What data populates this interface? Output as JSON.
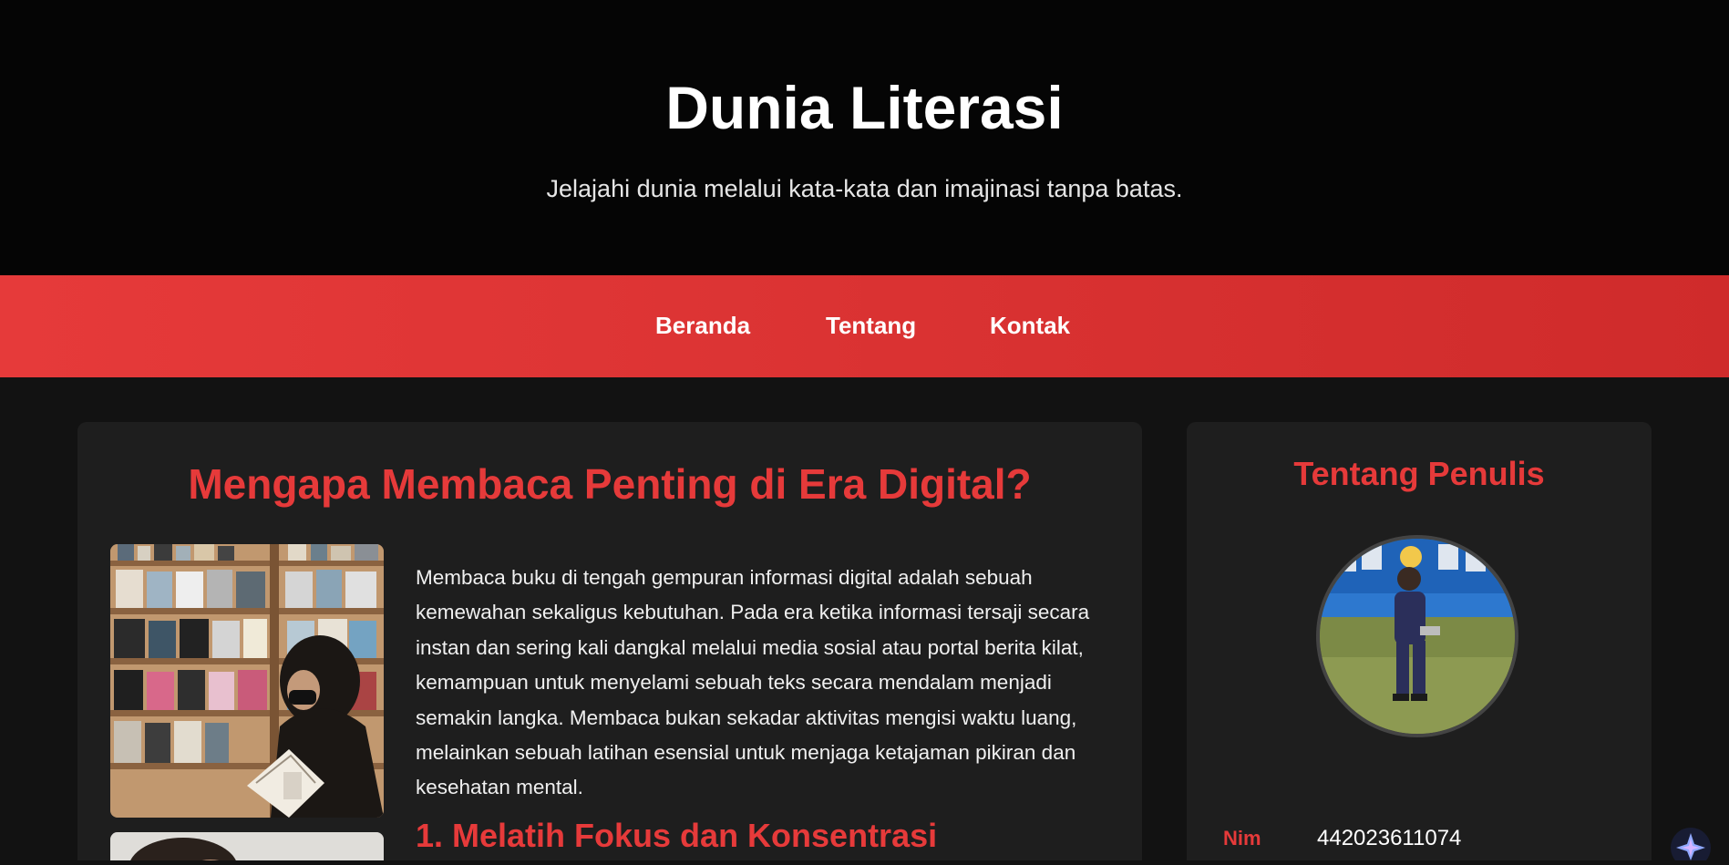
{
  "header": {
    "title": "Dunia Literasi",
    "tagline": "Jelajahi dunia melalui kata-kata dan imajinasi tanpa batas."
  },
  "nav": {
    "items": [
      {
        "label": "Beranda"
      },
      {
        "label": "Tentang"
      },
      {
        "label": "Kontak"
      }
    ]
  },
  "article": {
    "title": "Mengapa Membaca Penting di Era Digital?",
    "body": "Membaca buku di tengah gempuran informasi digital adalah sebuah kemewahan sekaligus kebutuhan. Pada era ketika informasi tersaji secara instan dan sering kali dangkal melalui media sosial atau portal berita kilat, kemampuan untuk menyelami sebuah teks secara mendalam menjadi semakin langka. Membaca bukan sekadar aktivitas mengisi waktu luang, melainkan sebuah latihan esensial untuk menjaga ketajaman pikiran dan kesehatan mental.",
    "section_heading": "1. Melatih Fokus dan Konsentrasi"
  },
  "sidebar": {
    "title": "Tentang Penulis",
    "info": [
      {
        "label": "Nim",
        "value": "442023611074"
      }
    ]
  },
  "colors": {
    "accent": "#e63a3a",
    "header_bg": "#050505",
    "page_bg": "#121212",
    "card_bg": "#1e1e1e"
  },
  "icons": {
    "corner_widget": "sparkle-icon"
  }
}
